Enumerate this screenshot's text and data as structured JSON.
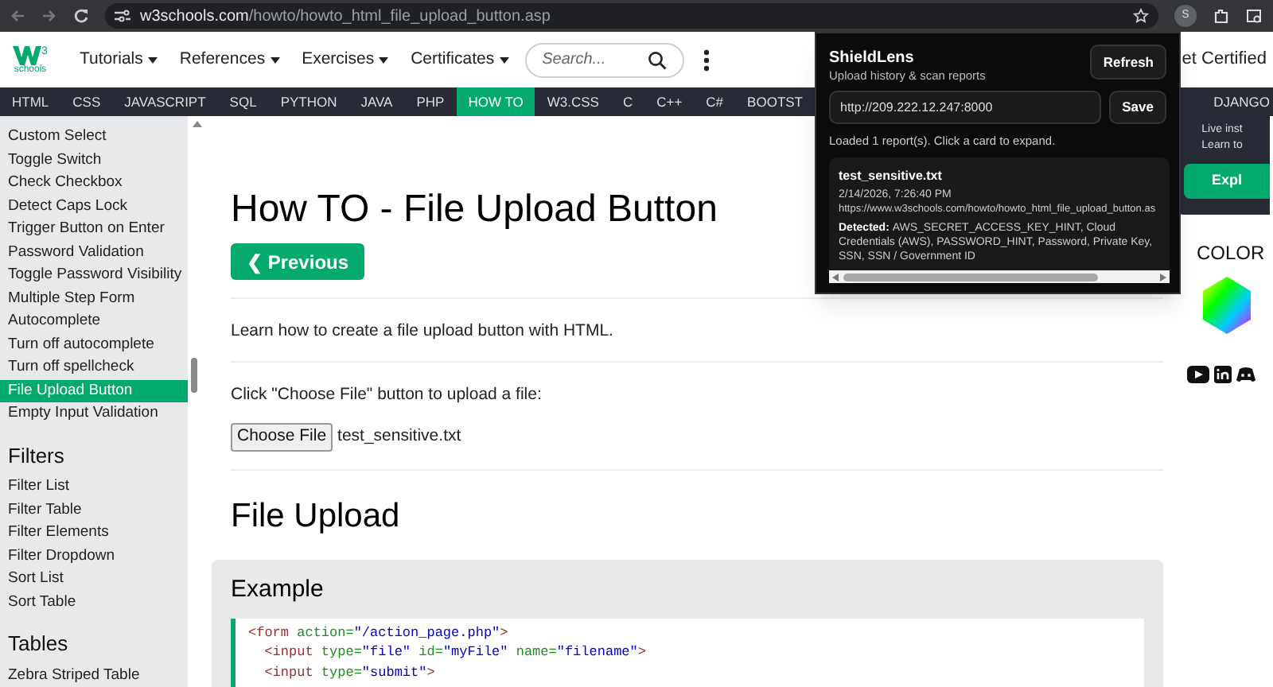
{
  "browser": {
    "url_host": "w3schools.com",
    "url_path": "/howto/howto_html_file_upload_button.asp",
    "profile_letter": "S"
  },
  "header": {
    "logo_sup": "3",
    "logo_text": "schools",
    "menus": [
      "Tutorials",
      "References",
      "Exercises",
      "Certificates"
    ],
    "search": {
      "placeholder": "Search..."
    },
    "certified": "et Certified"
  },
  "topnav": [
    {
      "label": "HTML",
      "selected": false
    },
    {
      "label": "CSS",
      "selected": false
    },
    {
      "label": "JAVASCRIPT",
      "selected": false
    },
    {
      "label": "SQL",
      "selected": false
    },
    {
      "label": "PYTHON",
      "selected": false
    },
    {
      "label": "JAVA",
      "selected": false
    },
    {
      "label": "PHP",
      "selected": false
    },
    {
      "label": "HOW TO",
      "selected": true
    },
    {
      "label": "W3.CSS",
      "selected": false
    },
    {
      "label": "C",
      "selected": false
    },
    {
      "label": "C++",
      "selected": false
    },
    {
      "label": "C#",
      "selected": false
    },
    {
      "label": "BOOTST",
      "selected": false
    },
    {
      "label": "DJANGO",
      "selected": false
    }
  ],
  "sidebar": {
    "sections": [
      {
        "items": [
          {
            "label": "Custom Select",
            "selected": false
          },
          {
            "label": "Toggle Switch",
            "selected": false
          },
          {
            "label": "Check Checkbox",
            "selected": false
          },
          {
            "label": "Detect Caps Lock",
            "selected": false
          },
          {
            "label": "Trigger Button on Enter",
            "selected": false
          },
          {
            "label": "Password Validation",
            "selected": false
          },
          {
            "label": "Toggle Password Visibility",
            "selected": false
          },
          {
            "label": "Multiple Step Form",
            "selected": false
          },
          {
            "label": "Autocomplete",
            "selected": false
          },
          {
            "label": "Turn off autocomplete",
            "selected": false
          },
          {
            "label": "Turn off spellcheck",
            "selected": false
          },
          {
            "label": "File Upload Button",
            "selected": true
          },
          {
            "label": "Empty Input Validation",
            "selected": false
          }
        ]
      },
      {
        "title": "Filters",
        "items": [
          {
            "label": "Filter List",
            "selected": false
          },
          {
            "label": "Filter Table",
            "selected": false
          },
          {
            "label": "Filter Elements",
            "selected": false
          },
          {
            "label": "Filter Dropdown",
            "selected": false
          },
          {
            "label": "Sort List",
            "selected": false
          },
          {
            "label": "Sort Table",
            "selected": false
          }
        ]
      },
      {
        "title": "Tables",
        "items": [
          {
            "label": "Zebra Striped Table",
            "selected": false
          }
        ]
      }
    ]
  },
  "main": {
    "title": "How TO - File Upload Button",
    "previous": "❮ Previous",
    "intro": "Learn how to create a file upload button with HTML.",
    "instruction": "Click \"Choose File\" button to upload a file:",
    "choose_file": "Choose File",
    "file_name": "test_sensitive.txt",
    "section_title": "File Upload",
    "example_title": "Example",
    "code_lines": [
      [
        {
          "kind": "tag",
          "s": "<form"
        },
        {
          "kind": "attr",
          "s": " action="
        },
        {
          "kind": "val",
          "s": "\"/action_page.php\""
        },
        {
          "kind": "tag",
          "s": ">"
        }
      ],
      [
        {
          "kind": "tag",
          "s": "  <input"
        },
        {
          "kind": "attr",
          "s": " type="
        },
        {
          "kind": "val",
          "s": "\"file\""
        },
        {
          "kind": "attr",
          "s": " id="
        },
        {
          "kind": "val",
          "s": "\"myFile\""
        },
        {
          "kind": "attr",
          "s": " name="
        },
        {
          "kind": "val",
          "s": "\"filename\""
        },
        {
          "kind": "tag",
          "s": ">"
        }
      ],
      [
        {
          "kind": "tag",
          "s": "  <input"
        },
        {
          "kind": "attr",
          "s": " type="
        },
        {
          "kind": "val",
          "s": "\"submit\""
        },
        {
          "kind": "tag",
          "s": ">"
        }
      ]
    ]
  },
  "right": {
    "promo_line_1": "Live inst",
    "promo_line_2": "Learn to",
    "promo_button": "Expl",
    "color_title": "COLOR"
  },
  "popup": {
    "title": "ShieldLens",
    "subtitle": "Upload history & scan reports",
    "refresh": "Refresh",
    "server_url": "http://209.222.12.247:8000",
    "save": "Save",
    "status": "Loaded 1 report(s). Click a card to expand.",
    "reports": [
      {
        "file": "test_sensitive.txt",
        "time": "2/14/2026, 7:26:40 PM",
        "url": "https://www.w3schools.com/howto/howto_html_file_upload_button.as",
        "detected_label": "Detected:",
        "detected": "AWS_SECRET_ACCESS_KEY_HINT, Cloud Credentials (AWS), PASSWORD_HINT, Password, Private Key, SSN, SSN / Government ID"
      }
    ]
  }
}
